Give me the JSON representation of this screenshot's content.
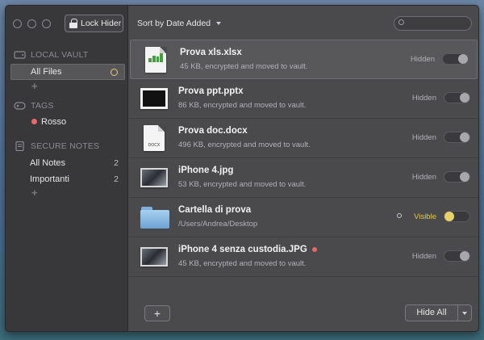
{
  "toolbar": {
    "lock_label": "Lock Hider",
    "sort_label": "Sort by Date Added",
    "search_placeholder": ""
  },
  "sidebar": {
    "local_vault": {
      "header": "LOCAL VAULT",
      "items": [
        {
          "label": "All Files"
        }
      ]
    },
    "tags": {
      "header": "TAGS",
      "items": [
        {
          "label": "Rosso",
          "color": "#e66a6a"
        }
      ]
    },
    "secure_notes": {
      "header": "SECURE NOTES",
      "items": [
        {
          "label": "All Notes",
          "count": "2"
        },
        {
          "label": "Importanti",
          "count": "2"
        }
      ]
    },
    "add_symbol": "+"
  },
  "files": [
    {
      "name": "Prova xls.xlsx",
      "sub": "45 KB, encrypted and moved to vault.",
      "status": "Hidden",
      "icon": "xlsx-file-icon"
    },
    {
      "name": "Prova ppt.pptx",
      "sub": "86 KB, encrypted and moved to vault.",
      "status": "Hidden",
      "icon": "pptx-file-icon"
    },
    {
      "name": "Prova doc.docx",
      "sub": "496 KB, encrypted and moved to vault.",
      "status": "Hidden",
      "icon": "docx-file-icon",
      "icon_label": "DOCX"
    },
    {
      "name": "iPhone 4.jpg",
      "sub": "53 KB, encrypted and moved to vault.",
      "status": "Hidden",
      "icon": "jpg-photo-icon"
    },
    {
      "name": "Cartella di prova",
      "sub": "/Users/Andrea/Desktop",
      "status": "Visible",
      "icon": "folder-icon"
    },
    {
      "name": "iPhone 4 senza custodia.JPG",
      "sub": "45 KB, encrypted and moved to vault.",
      "status": "Hidden",
      "icon": "jpg-photo-icon"
    }
  ],
  "footer": {
    "add_label": "+",
    "hide_all_label": "Hide All"
  },
  "colors": {
    "accent_visible": "#e8c84a",
    "tag_red": "#e66a6a"
  }
}
